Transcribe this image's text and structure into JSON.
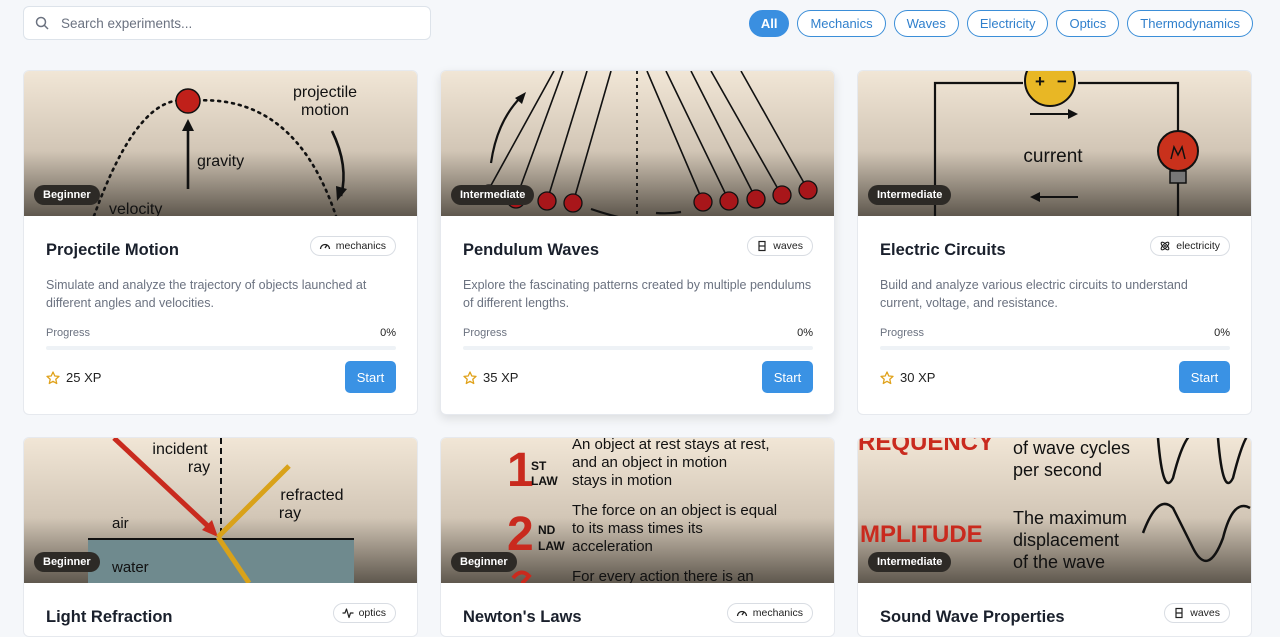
{
  "search": {
    "placeholder": "Search experiments..."
  },
  "filters": [
    "All",
    "Mechanics",
    "Waves",
    "Electricity",
    "Optics",
    "Thermodynamics"
  ],
  "active_filter": "All",
  "progress_label": "Progress",
  "start_label": "Start",
  "cards": [
    {
      "title": "Projectile Motion",
      "tag": "mechanics",
      "tag_icon": "gauge-icon",
      "level": "Beginner",
      "description": "Simulate and analyze the trajectory of objects launched at different angles and velocities.",
      "progress": "0%",
      "progress_fraction": 0,
      "xp": "25 XP",
      "image_text": [
        "projectile",
        "motion",
        "gravity",
        "velocity"
      ]
    },
    {
      "title": "Pendulum Waves",
      "tag": "waves",
      "tag_icon": "waves-icon",
      "level": "Intermediate",
      "description": "Explore the fascinating patterns created by multiple pendulums of different lengths.",
      "progress": "0%",
      "progress_fraction": 0,
      "xp": "35 XP",
      "image_text": []
    },
    {
      "title": "Electric Circuits",
      "tag": "electricity",
      "tag_icon": "atom-icon",
      "level": "Intermediate",
      "description": "Build and analyze various electric circuits to understand current, voltage, and resistance.",
      "progress": "0%",
      "progress_fraction": 0,
      "xp": "30 XP",
      "image_text": [
        "current",
        "+",
        "−"
      ]
    },
    {
      "title": "Light Refraction",
      "tag": "optics",
      "tag_icon": "pulse-icon",
      "level": "Beginner",
      "image_text": [
        "incident",
        "ray",
        "refracted",
        "ray",
        "air",
        "water"
      ]
    },
    {
      "title": "Newton's Laws",
      "tag": "mechanics",
      "tag_icon": "gauge-icon",
      "level": "Beginner",
      "image_text": [
        "1",
        "ST",
        "LAW",
        "An object at rest stays at rest,",
        "and an object in motion",
        "stays in motion",
        "2",
        "ND",
        "LAW",
        "The force on an object is equal",
        "to its mass times its",
        "acceleration",
        "For every action there is an"
      ]
    },
    {
      "title": "Sound Wave Properties",
      "tag": "waves",
      "tag_icon": "waves-icon",
      "level": "Intermediate",
      "image_text": [
        "REQUENCY",
        "of wave cycles",
        "per second",
        "MPLITUDE",
        "The maximum",
        "displacement",
        "of the wave"
      ]
    }
  ],
  "colors": {
    "accent": "#3a8fe0",
    "badge_bg": "#2d2a26",
    "ball_red": "#c0201a",
    "star": "#e0a21b"
  }
}
